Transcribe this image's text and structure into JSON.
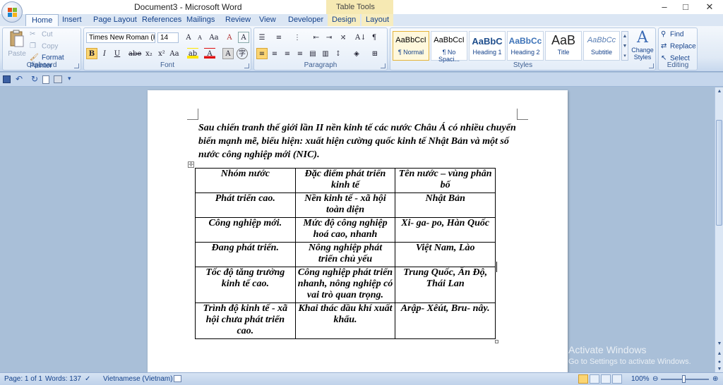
{
  "window": {
    "title": "Document3 - Microsoft Word",
    "contextual_label": "Table Tools",
    "controls": [
      "–",
      "□",
      "✕"
    ]
  },
  "tabs": [
    "Home",
    "Insert",
    "Page Layout",
    "References",
    "Mailings",
    "Review",
    "View",
    "Developer",
    "Design",
    "Layout"
  ],
  "ribbon": {
    "clipboard": {
      "label": "Clipboard",
      "paste": "Paste",
      "cut": "Cut",
      "copy": "Copy",
      "format_painter": "Format Painter"
    },
    "font": {
      "label": "Font",
      "font_name": "Times New Roman (Hea",
      "font_size": "14",
      "buttons": [
        "B",
        "I",
        "U",
        "abe",
        "x₂",
        "x²",
        "Aa",
        "A"
      ]
    },
    "paragraph": {
      "label": "Paragraph"
    },
    "styles": {
      "label": "Styles",
      "items": [
        {
          "preview": "AaBbCcI",
          "name": "¶ Normal"
        },
        {
          "preview": "AaBbCcI",
          "name": "¶ No Spaci..."
        },
        {
          "preview": "AaBbC",
          "name": "Heading 1"
        },
        {
          "preview": "AaBbCc",
          "name": "Heading 2"
        },
        {
          "preview": "AaB",
          "name": "Title"
        },
        {
          "preview": "AaBbCc",
          "name": "Subtitle"
        }
      ],
      "change_styles": "Change Styles"
    },
    "editing": {
      "label": "Editing",
      "find": "Find",
      "replace": "Replace",
      "select": "Select"
    }
  },
  "document": {
    "paragraph": "Sau chiến tranh thế giới lần II nền kinh tế các nước Châu Á có nhiều chuyển biến mạnh mẽ, biểu hiện: xuất hiện cường quốc kinh tế Nhật Bản và một số nước công nghiệp mới (NIC).",
    "table": [
      [
        "Nhóm nước",
        "Đặc điểm phát triển kinh tế",
        "Tên nước – vùng phân bố"
      ],
      [
        "Phát triển cao.",
        "Nền kinh tế - xã hội toàn diện",
        "Nhật Bản"
      ],
      [
        "Công nghiệp mới.",
        "Mức độ công nghiệp hoá cao, nhanh",
        "Xi- ga- po, Hàn Quốc"
      ],
      [
        "Đang phát triển.",
        "Nông nghiệp phát triển chủ yếu",
        "Việt Nam, Lào"
      ],
      [
        "Tốc độ tăng trưởng kinh tế cao.",
        "Công nghiệp phát triển nhanh, nông nghiệp có vai trò quan trọng.",
        "Trung Quốc, Ấn Độ, Thái Lan"
      ],
      [
        "Trình độ kinh tế - xã hội chưa phát triển cao.",
        "Khai thác dầu khí xuất khẩu.",
        "Arập- Xêút, Bru- nây."
      ]
    ]
  },
  "watermark": {
    "line1": "Activate Windows",
    "line2": "Go to Settings to activate Windows."
  },
  "statusbar": {
    "page": "Page: 1 of 1",
    "words": "Words: 137",
    "language": "Vietnamese (Vietnam)",
    "zoom": "100%"
  }
}
